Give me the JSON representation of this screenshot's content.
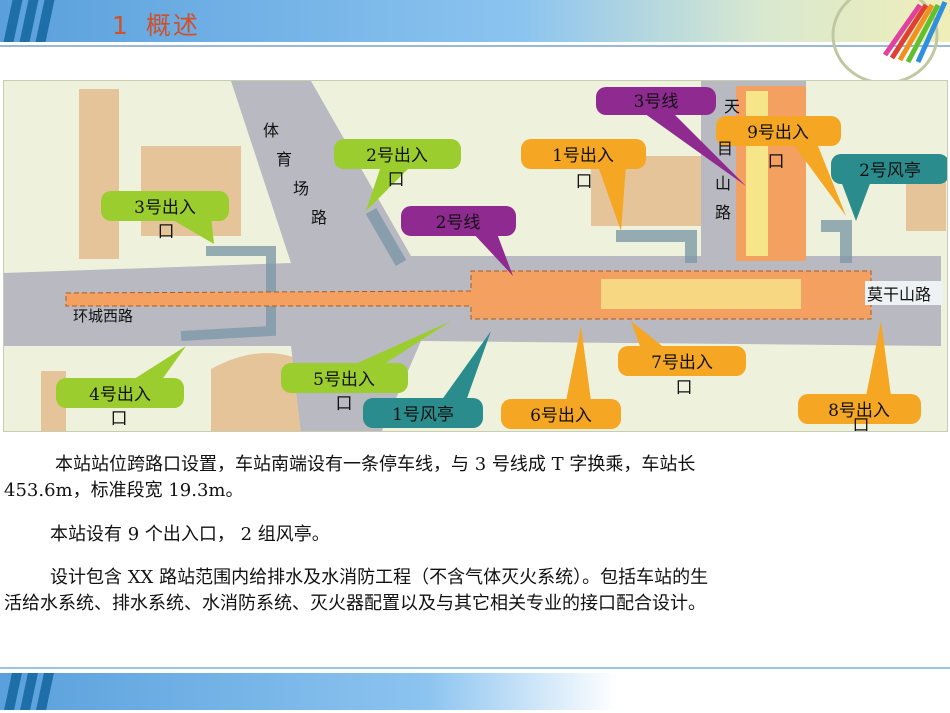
{
  "header": {
    "number": "1",
    "title": "概述"
  },
  "map": {
    "roads": {
      "tiyuchang": [
        "体",
        "育",
        "场",
        "路"
      ],
      "tianmushan": [
        "天",
        "目",
        "山",
        "路"
      ],
      "huanchengxi": "环城西路",
      "moganshan": "莫干山路"
    },
    "callouts": {
      "line3": "3号线",
      "line2": "2号线",
      "exit9": "9号出入",
      "exit9_tail": "口",
      "vent2": "2号风亭",
      "exit1": "1号出入",
      "exit1_tail": "口",
      "exit2": "2号出入",
      "exit2_tail": "口",
      "exit3": "3号出入",
      "exit3_tail": "口",
      "exit4": "4号出入",
      "exit4_tail": "口",
      "exit5": "5号出入",
      "exit5_tail": "口",
      "vent1": "1号风亭",
      "exit6": "6号出入",
      "exit6_tail": "口",
      "exit7": "7号出入",
      "exit7_tail": "口",
      "exit8": "8号出入",
      "exit8_tail": "口"
    },
    "colors": {
      "purple": "#8e2a90",
      "orange": "#f5a623",
      "lime": "#9ccd2e",
      "teal": "#2a8c8c",
      "station": "#f3a060",
      "road": "#b9b9c1",
      "ground": "#eef2dc"
    }
  },
  "body": {
    "p1_line1": "本站站位跨路口设置，车站南端设有一条停车线，与 3 号线成 T 字换乘，车站长",
    "p1_line2": "453.6m，标准段宽 19.3m。",
    "p2": "本站设有 9 个出入口， 2 组风亭。",
    "p3_line1": "设计包含 XX 路站范围内给排水及水消防工程（不含气体灭火系统）。包括车站的生",
    "p3_line2": "活给水系统、排水系统、水消防系统、灭火器配置以及与其它相关专业的接口配合设计。"
  }
}
